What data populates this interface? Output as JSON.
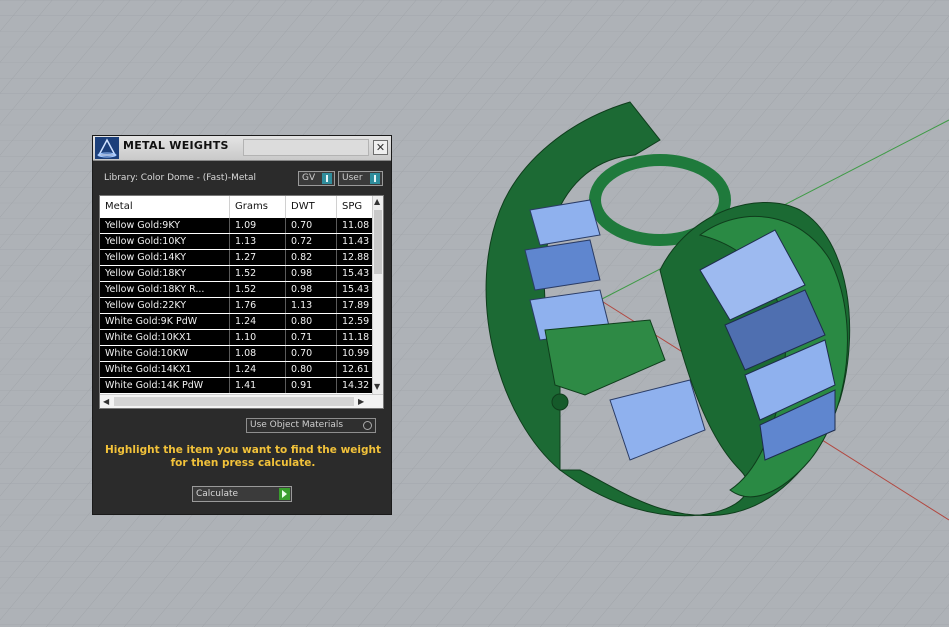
{
  "panel": {
    "title": "METAL WEIGHTS",
    "close_icon": "close-icon",
    "library_label": "Library: Color Dome - (Fast)-Metal",
    "toggles": [
      {
        "label": "GV"
      },
      {
        "label": "User"
      }
    ],
    "table": {
      "columns": [
        "Metal",
        "Grams",
        "DWT",
        "SPG"
      ],
      "rows": [
        [
          "Yellow Gold:9KY",
          "1.09",
          "0.70",
          "11.08"
        ],
        [
          "Yellow Gold:10KY",
          "1.13",
          "0.72",
          "11.43"
        ],
        [
          "Yellow Gold:14KY",
          "1.27",
          "0.82",
          "12.88"
        ],
        [
          "Yellow Gold:18KY",
          "1.52",
          "0.98",
          "15.43"
        ],
        [
          "Yellow Gold:18KY R...",
          "1.52",
          "0.98",
          "15.43"
        ],
        [
          "Yellow Gold:22KY",
          "1.76",
          "1.13",
          "17.89"
        ],
        [
          "White Gold:9K PdW",
          "1.24",
          "0.80",
          "12.59"
        ],
        [
          "White Gold:10KX1",
          "1.10",
          "0.71",
          "11.18"
        ],
        [
          "White Gold:10KW",
          "1.08",
          "0.70",
          "10.99"
        ],
        [
          "White Gold:14KX1",
          "1.24",
          "0.80",
          "12.61"
        ],
        [
          "White Gold:14K PdW",
          "1.41",
          "0.91",
          "14.32"
        ]
      ]
    },
    "use_object_materials": "Use Object Materials",
    "instructions": "Highlight the item you want to find the weight for then press calculate.",
    "calculate_label": "Calculate",
    "colors": {
      "accent": "#f2c23a",
      "ring": "#1e7a3a",
      "gem": "#7fa6e8"
    }
  }
}
